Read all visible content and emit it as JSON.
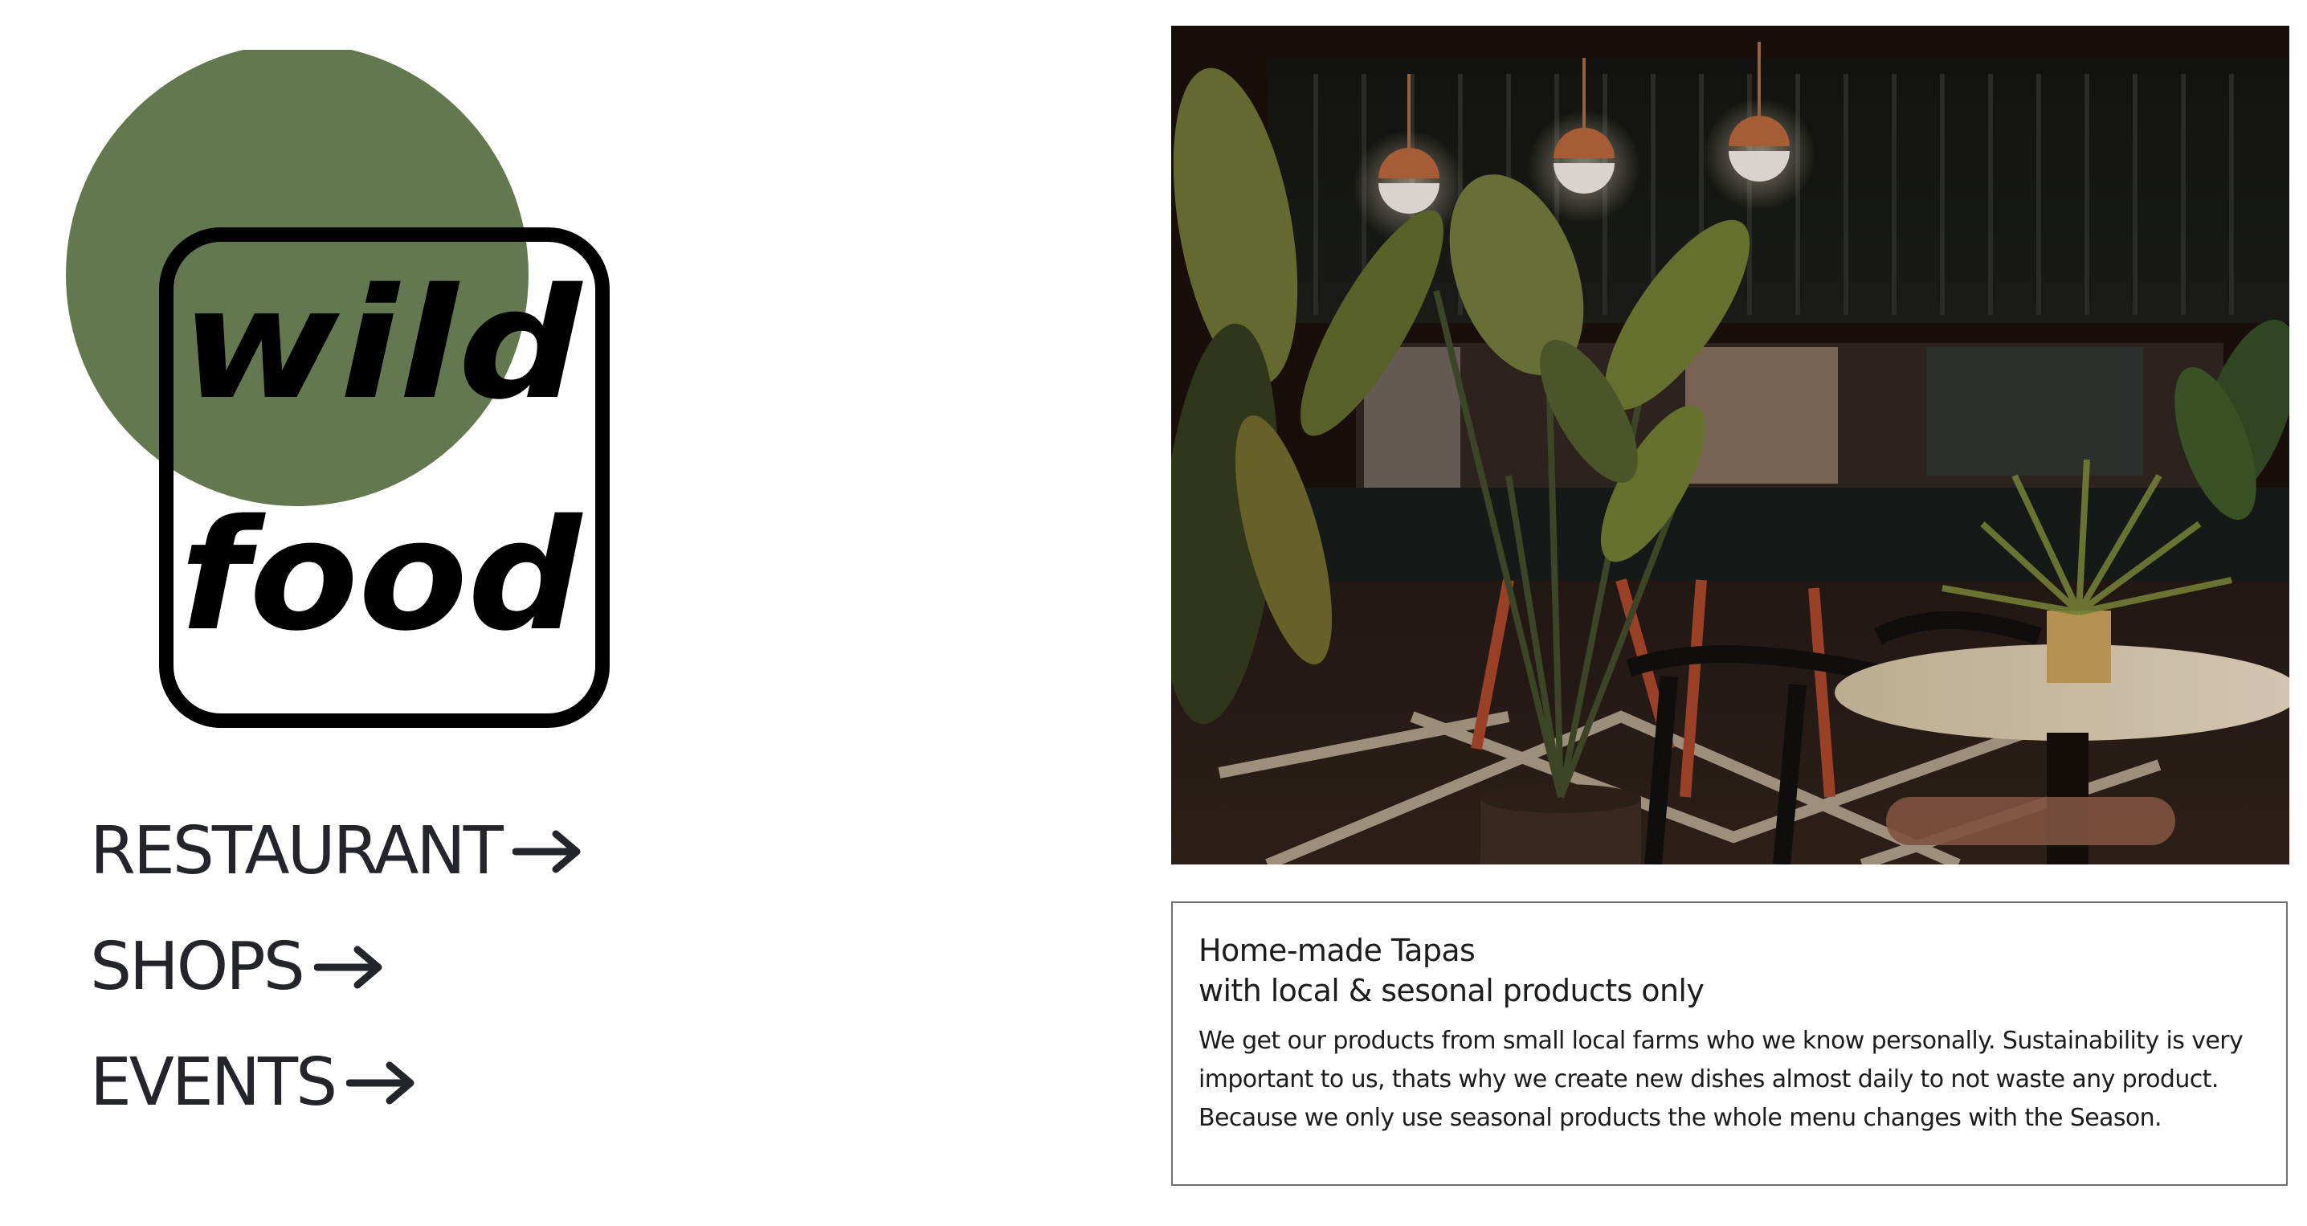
{
  "brand": {
    "logo_words": [
      "wild",
      "food"
    ],
    "circle_color": "#64784f",
    "ink_color": "#000000"
  },
  "nav": {
    "items": [
      {
        "label": "RESTAURANT",
        "icon": "arrow-right-icon"
      },
      {
        "label": "SHOPS",
        "icon": "arrow-right-icon"
      },
      {
        "label": "EVENTS",
        "icon": "arrow-right-icon"
      }
    ],
    "text_color": "#23252b"
  },
  "hero": {
    "subject": "restaurant-interior-photo"
  },
  "card": {
    "title_line1": "Home-made Tapas",
    "title_line2": "with local & sesonal products only",
    "body": "We get our products from small local farms who we know personally. Sustainability is very important to us, thats why we create new dishes almost daily to not waste any product. Because we only use seasonal products the whole menu changes with the Season.",
    "border_color": "#6f6f6f"
  }
}
